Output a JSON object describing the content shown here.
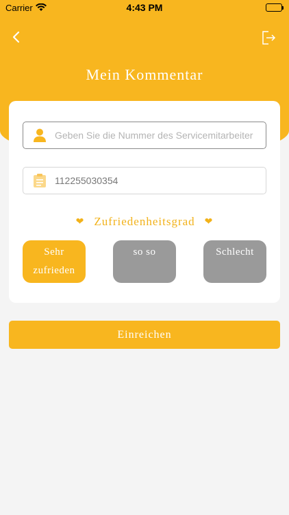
{
  "status_bar": {
    "carrier": "Carrier",
    "time": "4:43 PM",
    "wifi_icon": "wifi-icon",
    "battery_icon": "battery-icon"
  },
  "nav": {
    "back_icon": "chevron-left-icon",
    "logout_icon": "logout-icon",
    "title": "Mein Kommentar"
  },
  "form": {
    "employee_field": {
      "icon": "user-icon",
      "placeholder": "Geben Sie die Nummer des Servicemitarbeiters ein",
      "value": ""
    },
    "order_field": {
      "icon": "clipboard-icon",
      "value": "112255030354"
    },
    "satisfaction_label": "Zufriedenheitsgrad",
    "ratings": [
      {
        "line1": "Sehr",
        "line2": "zufrieden",
        "selected": true
      },
      {
        "line1": "so so",
        "line2": "",
        "selected": false
      },
      {
        "line1": "Schlecht",
        "line2": "",
        "selected": false
      }
    ]
  },
  "submit_label": "Einreichen",
  "colors": {
    "accent": "#f8b61f",
    "background": "#f4f4f4",
    "unselected": "#9a9a9a"
  }
}
